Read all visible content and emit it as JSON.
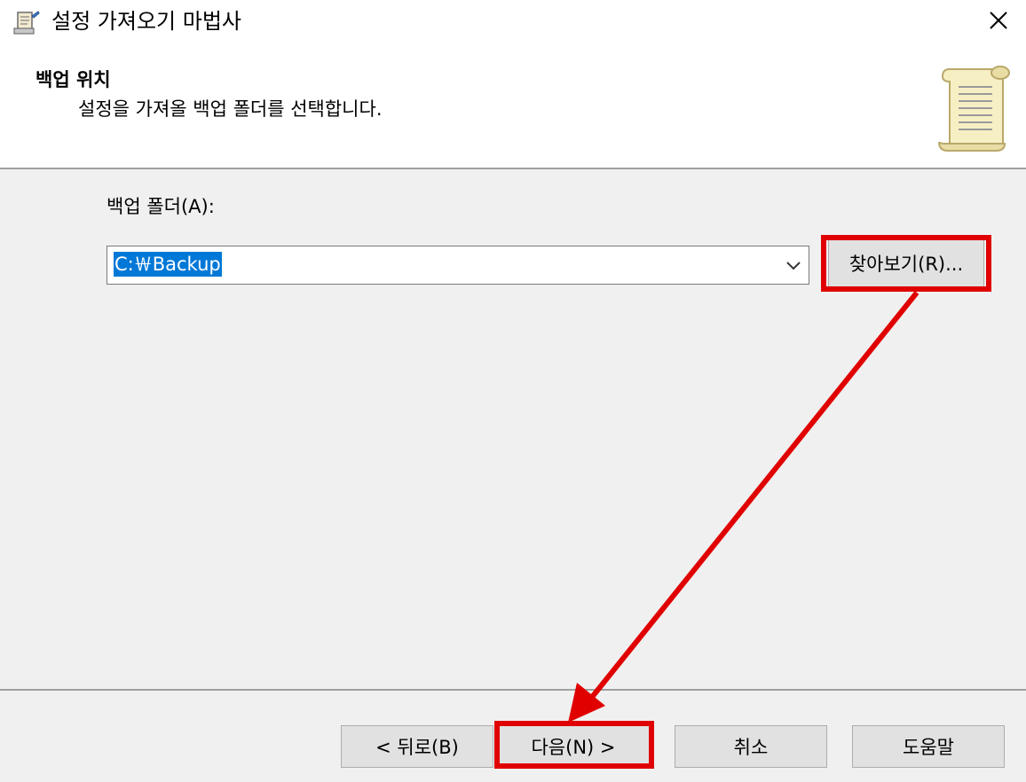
{
  "window": {
    "title": "설정 가져오기 마법사",
    "close_icon": "close-icon",
    "app_icon": "wizard-icon"
  },
  "header": {
    "title": "백업 위치",
    "subtitle": "설정을 가져올 백업 폴더를 선택합니다.",
    "icon": "scroll-icon"
  },
  "backup_folder": {
    "label": "백업 폴더(A):",
    "value": "C:￦Backup",
    "browse_label": "찾아보기(R)..."
  },
  "footer": {
    "back_label": "< 뒤로(B)",
    "next_label": "다음(N) >",
    "cancel_label": "취소",
    "help_label": "도움말"
  },
  "annotations": {
    "highlight_color": "#e00000"
  }
}
